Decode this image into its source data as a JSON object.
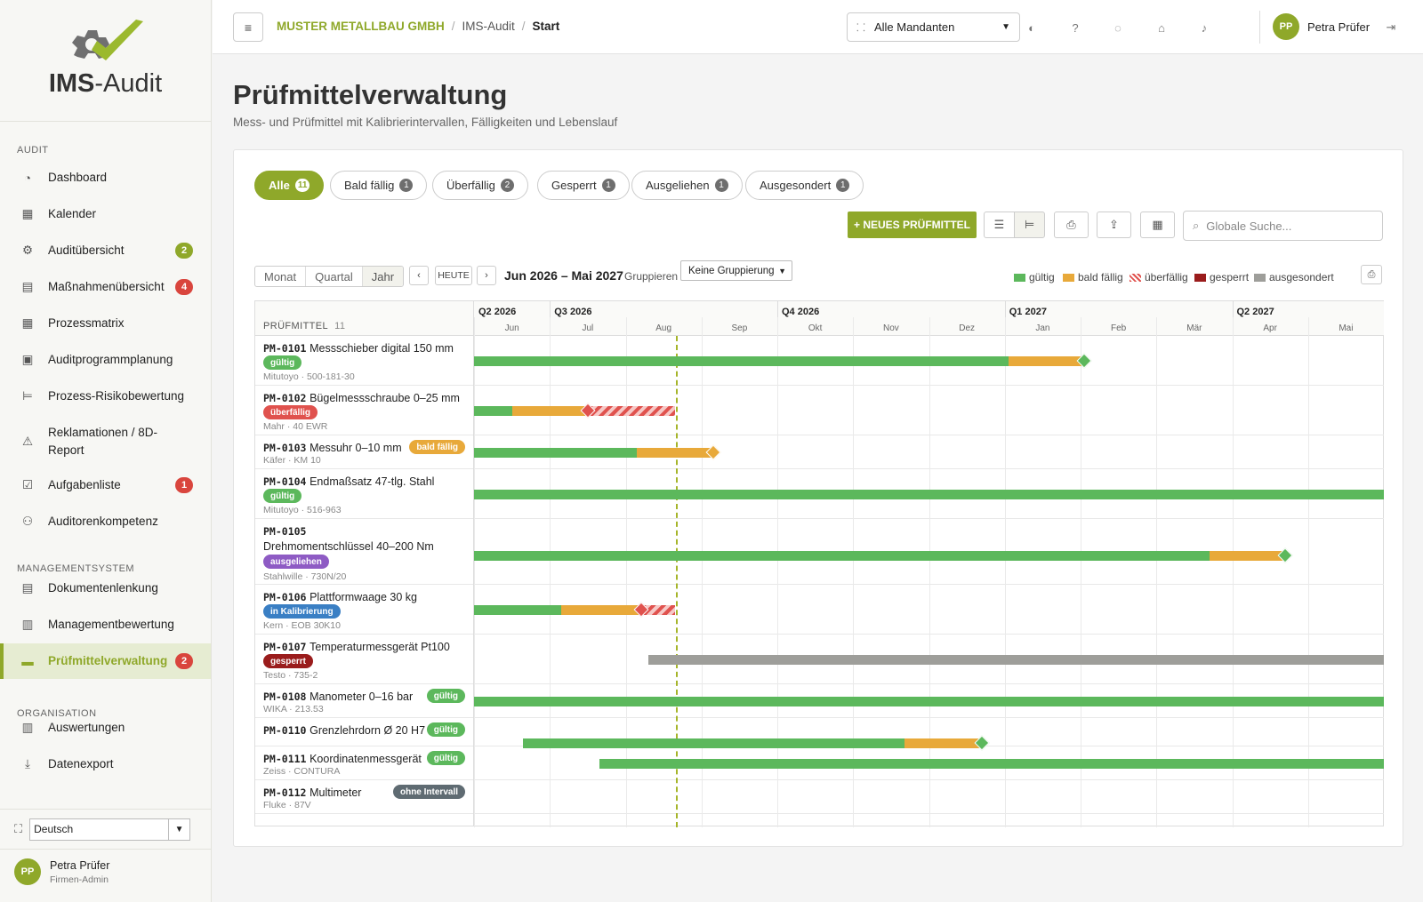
{
  "app": {
    "title_bold": "IMS",
    "title_rest": "-Audit"
  },
  "sidebar": {
    "sections": [
      "AUDIT",
      "MANAGEMENTSYSTEM",
      "ORGANISATION"
    ],
    "items": [
      {
        "label": "Dashboard",
        "icon": "gauge-icon"
      },
      {
        "label": "Kalender",
        "icon": "calendar-icon"
      },
      {
        "label": "Auditübersicht",
        "icon": "gear-icon",
        "badge": "2",
        "badge_color": "#8fa82a"
      },
      {
        "label": "Maßnahmenübersicht",
        "icon": "clipboard-icon",
        "badge": "4",
        "badge_color": "#d9453d"
      },
      {
        "label": "Prozessmatrix",
        "icon": "grid-icon"
      },
      {
        "label": "Auditprogrammplanung",
        "icon": "calendar-plan-icon"
      },
      {
        "label": "Prozess-Risikobewertung",
        "icon": "list-tree-icon"
      },
      {
        "label": "Reklamationen / 8D-",
        "label2": "Report",
        "icon": "warning-icon"
      },
      {
        "label": "Aufgabenliste",
        "icon": "checkbox-icon",
        "badge": "1",
        "badge_color": "#d9453d"
      },
      {
        "label": "Auditorenkompetenz",
        "icon": "users-icon"
      },
      {
        "label": "Dokumentenlenkung",
        "icon": "document-icon"
      },
      {
        "label": "Managementbewertung",
        "icon": "clipboard-check-icon"
      },
      {
        "label": "Prüfmittelverwaltung",
        "icon": "ruler-icon",
        "badge": "2",
        "badge_color": "#d9453d",
        "active": true
      },
      {
        "label": "Auswertungen",
        "icon": "report-icon"
      },
      {
        "label": "Datenexport",
        "icon": "download-icon"
      }
    ],
    "language": "Deutsch",
    "user": {
      "initials": "PP",
      "name": "Petra Prüfer",
      "role": "Firmen-Admin"
    }
  },
  "topbar": {
    "breadcrumb": [
      "MUSTER METALLBAU GMBH",
      "IMS-Audit",
      "Start"
    ],
    "tenant": "Alle Mandanten",
    "user_name": "Petra Prüfer",
    "user_initials": "PP"
  },
  "page": {
    "title": "Prüfmittelverwaltung",
    "subtitle": "Mess- und Prüfmittel mit Kalibrierintervallen, Fälligkeiten und Lebenslauf"
  },
  "filters": [
    {
      "label": "Alle",
      "count": "11",
      "active": true
    },
    {
      "label": "Bald fällig",
      "count": "1"
    },
    {
      "label": "Überfällig",
      "count": "2"
    },
    {
      "label": "Gesperrt",
      "count": "1"
    },
    {
      "label": "Ausgeliehen",
      "count": "1"
    },
    {
      "label": "Ausgesondert",
      "count": "1"
    }
  ],
  "toolbar": {
    "new_button": "+ NEUES PRÜFMITTEL",
    "search_placeholder": "Globale Suche..."
  },
  "timeline": {
    "views": [
      "Monat",
      "Quartal",
      "Jahr"
    ],
    "active_view": "Jahr",
    "today_label": "HEUTE",
    "range": "Jun 2026 – Mai 2027",
    "group_label": "Gruppieren",
    "group_value": "Keine Gruppierung",
    "legend": [
      {
        "label": "gültig",
        "color": "#5cb85c"
      },
      {
        "label": "bald fällig",
        "color": "#e8a93a"
      },
      {
        "label": "überfällig",
        "color": "#e0524e"
      },
      {
        "label": "gesperrt",
        "color": "#9a1c1c"
      },
      {
        "label": "ausgesondert",
        "color": "#9e9e9a"
      }
    ],
    "column_header": "PRÜFMITTEL",
    "column_count": "11",
    "quarters": [
      "Q2 2026",
      "Q3 2026",
      "Q4 2026",
      "Q1 2027",
      "Q2 2027"
    ],
    "months": [
      "Jun",
      "Jul",
      "Aug",
      "Sep",
      "Okt",
      "Nov",
      "Dez",
      "Jan",
      "Feb",
      "Mär",
      "Apr",
      "Mai"
    ]
  },
  "items": [
    {
      "id": "PM-0101",
      "name": "Messschieber digital 150 mm",
      "status": "gültig",
      "status_color": "#5cb85c",
      "meta": "Mitutoyo · 500-181-30"
    },
    {
      "id": "PM-0102",
      "name": "Bügelmessschraube 0–25 mm",
      "status": "überfällig",
      "status_color": "#e0524e",
      "meta": "Mahr · 40 EWR"
    },
    {
      "id": "PM-0103",
      "name": "Messuhr 0–10 mm",
      "status": "bald fällig",
      "status_color": "#e8a93a",
      "meta": "Käfer · KM 10"
    },
    {
      "id": "PM-0104",
      "name": "Endmaßsatz 47-tlg. Stahl",
      "status": "gültig",
      "status_color": "#5cb85c",
      "meta": "Mitutoyo · 516-963"
    },
    {
      "id": "PM-0105",
      "name": "Drehmomentschlüssel 40–200 Nm",
      "status": "ausgeliehen",
      "status_color": "#8e5bc4",
      "meta": "Stahlwille · 730N/20"
    },
    {
      "id": "PM-0106",
      "name": "Plattformwaage 30 kg",
      "status": "in Kalibrierung",
      "status_color": "#3a7fc4",
      "meta": "Kern · EOB 30K10"
    },
    {
      "id": "PM-0107",
      "name": "Temperaturmessgerät Pt100",
      "status": "gesperrt",
      "status_color": "#9a1c1c",
      "meta": "Testo · 735-2"
    },
    {
      "id": "PM-0108",
      "name": "Manometer 0–16 bar",
      "status": "gültig",
      "status_color": "#5cb85c",
      "meta": "WIKA · 213.53"
    },
    {
      "id": "PM-0110",
      "name": "Grenzlehrdorn Ø 20 H7",
      "status": "gültig",
      "status_color": "#5cb85c",
      "meta": ""
    },
    {
      "id": "PM-0111",
      "name": "Koordinatenmessgerät",
      "status": "gültig",
      "status_color": "#5cb85c",
      "meta": "Zeiss · CONTURA"
    },
    {
      "id": "PM-0112",
      "name": "Multimeter",
      "status": "ohne Intervall",
      "status_color": "#5f6b72",
      "meta": "Fluke · 87V"
    }
  ]
}
